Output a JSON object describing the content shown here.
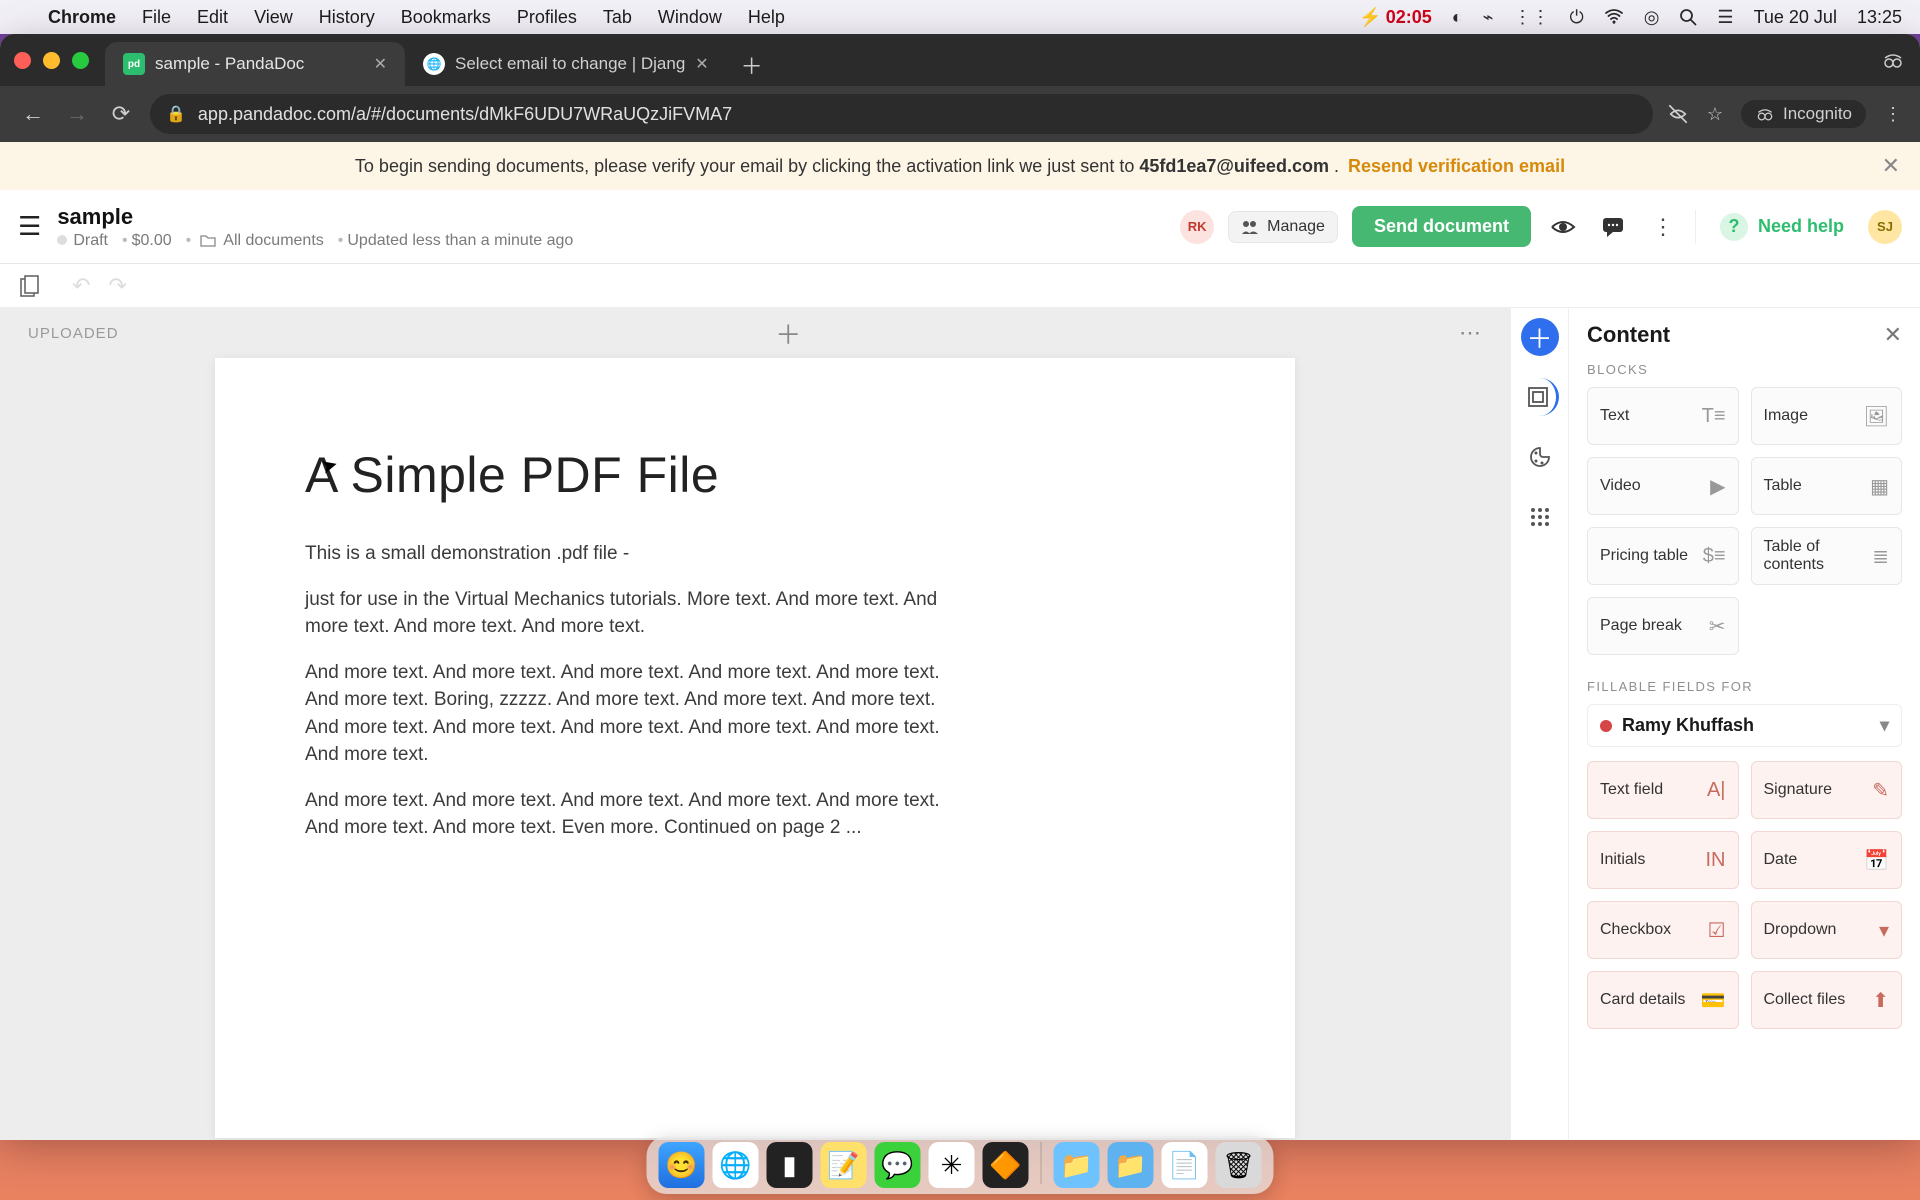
{
  "mac_menu": {
    "app": "Chrome",
    "items": [
      "File",
      "Edit",
      "View",
      "History",
      "Bookmarks",
      "Profiles",
      "Tab",
      "Window",
      "Help"
    ],
    "battery_time": "02:05",
    "date": "Tue 20 Jul",
    "clock": "13:25"
  },
  "browser": {
    "tabs": [
      {
        "title": "sample - PandaDoc",
        "active": true,
        "fav": "pd"
      },
      {
        "title": "Select email to change | Djang",
        "active": false,
        "fav": "dj"
      }
    ],
    "url": "app.pandadoc.com/a/#/documents/dMkF6UDU7WRaUQzJiFVMA7",
    "incognito_label": "Incognito"
  },
  "banner": {
    "prefix": "To begin sending documents, please verify your email by clicking the activation link we just sent to ",
    "email": "45fd1ea7@uifeed.com",
    "suffix": ". ",
    "resend": "Resend verification email"
  },
  "doc": {
    "title": "sample",
    "status": "Draft",
    "amount": "$0.00",
    "location": "All documents",
    "updated": "Updated less than a minute ago"
  },
  "header_actions": {
    "avatar1": "RK",
    "manage": "Manage",
    "send": "Send document",
    "need_help": "Need help",
    "avatar2": "SJ"
  },
  "canvas": {
    "uploaded_label": "UPLOADED",
    "page": {
      "heading": "A Simple PDF File",
      "p1": "This is a small demonstration .pdf file -",
      "p2": "just for use in the Virtual Mechanics tutorials. More text. And more text. And more text. And more text. And more text.",
      "p3": "And more text. And more text. And more text. And more text. And more text. And more text. Boring, zzzzz. And more text. And more text. And more text. And more text. And more text. And more text. And more text. And more text. And more text.",
      "p4": "And more text. And more text. And more text. And more text. And more text. And more text. And more text. Even more. Continued on page 2 ..."
    }
  },
  "panel": {
    "title": "Content",
    "blocks_label": "BLOCKS",
    "blocks": {
      "text": "Text",
      "image": "Image",
      "video": "Video",
      "table": "Table",
      "pricing": "Pricing table",
      "toc": "Table of contents",
      "pagebreak": "Page break"
    },
    "fillable_label": "FILLABLE FIELDS FOR",
    "assignee": "Ramy Khuffash",
    "fields": {
      "text": "Text field",
      "signature": "Signature",
      "initials": "Initials",
      "date": "Date",
      "checkbox": "Checkbox",
      "dropdown": "Dropdown",
      "card": "Card details",
      "collect": "Collect files"
    }
  }
}
